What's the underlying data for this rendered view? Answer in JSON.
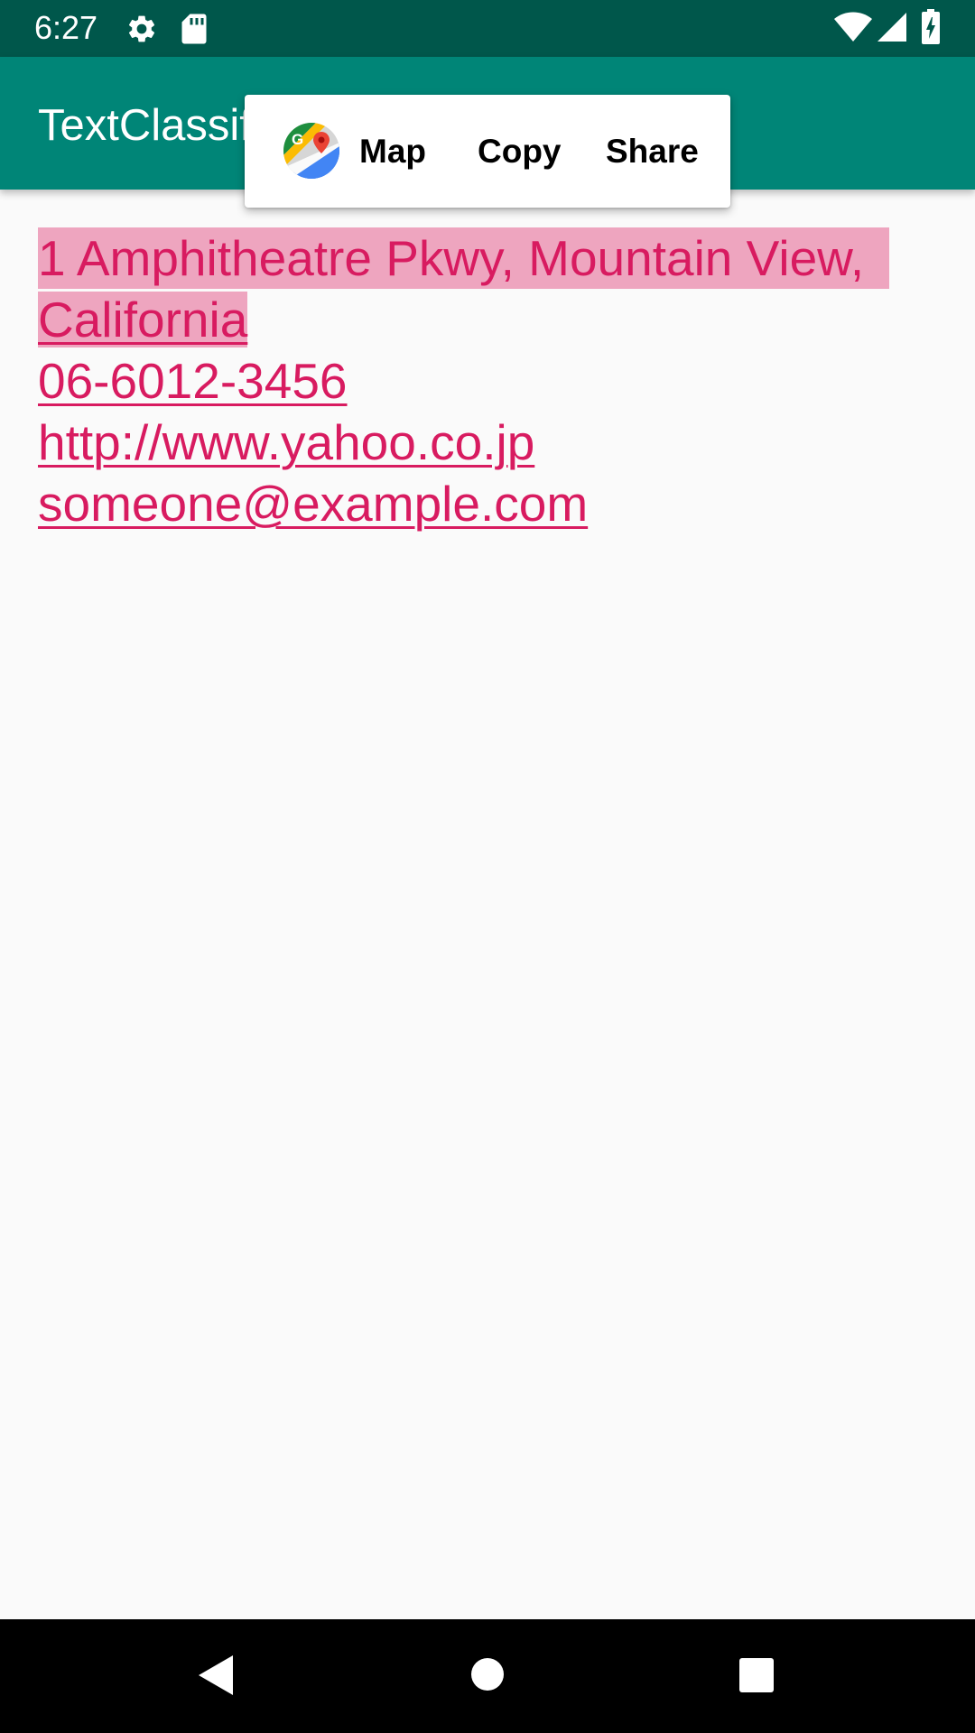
{
  "status_bar": {
    "time": "6:27",
    "icons": [
      "gear-icon",
      "sd-card-icon",
      "wifi-icon",
      "cell-signal-icon",
      "battery-charging-icon"
    ]
  },
  "app_bar": {
    "title": "TextClassifier"
  },
  "content": {
    "address_line1": "1 Amphitheatre Pkwy, Mountain View,",
    "address_line2": "California",
    "phone": "06-6012-3456",
    "url": "http://www.yahoo.co.jp",
    "email": "someone@example.com"
  },
  "selection_popup": {
    "app_icon": "google-maps-icon",
    "actions": [
      {
        "label": "Map"
      },
      {
        "label": "Copy"
      },
      {
        "label": "Share"
      }
    ]
  },
  "nav_bar": {
    "buttons": [
      "back-icon",
      "home-icon",
      "recents-icon"
    ]
  },
  "colors": {
    "status_bar": "#00574b",
    "app_bar": "#008577",
    "link_text": "#d81b60",
    "selection_highlight": "#eea5bf",
    "background": "#fafafa"
  }
}
